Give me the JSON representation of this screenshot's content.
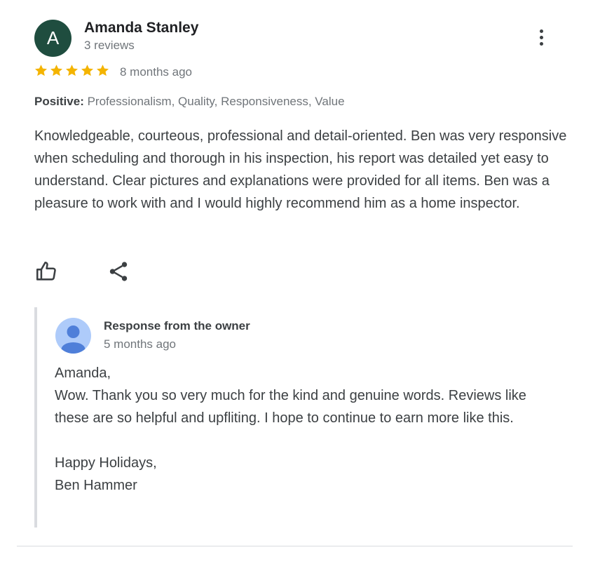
{
  "reviewer": {
    "initial": "A",
    "name": "Amanda Stanley",
    "review_count": "3 reviews",
    "avatar_color": "#1f4d3f"
  },
  "review": {
    "rating": 5,
    "max_rating": 5,
    "star_color": "#f4b400",
    "date": "8 months ago",
    "positive_label": "Positive:",
    "positive_values": "Professionalism, Quality, Responsiveness, Value",
    "text": "Knowledgeable, courteous, professional and detail-oriented. Ben was very responsive when scheduling and thorough in his inspection, his report was detailed yet easy to understand. Clear pictures and explanations were provided for all items. Ben was a pleasure to work with and I would highly recommend him as a home inspector."
  },
  "actions": {
    "like_icon": "thumb-up-icon",
    "share_icon": "share-icon",
    "more_icon": "more-vert-icon"
  },
  "owner_response": {
    "title": "Response from the owner",
    "date": "5 months ago",
    "text": "Amanda,\nWow. Thank you so very much for the kind and genuine words. Reviews like these are so helpful and upfliting. I hope to continue to earn more like this.\n\nHappy Holidays,\nBen Hammer"
  }
}
